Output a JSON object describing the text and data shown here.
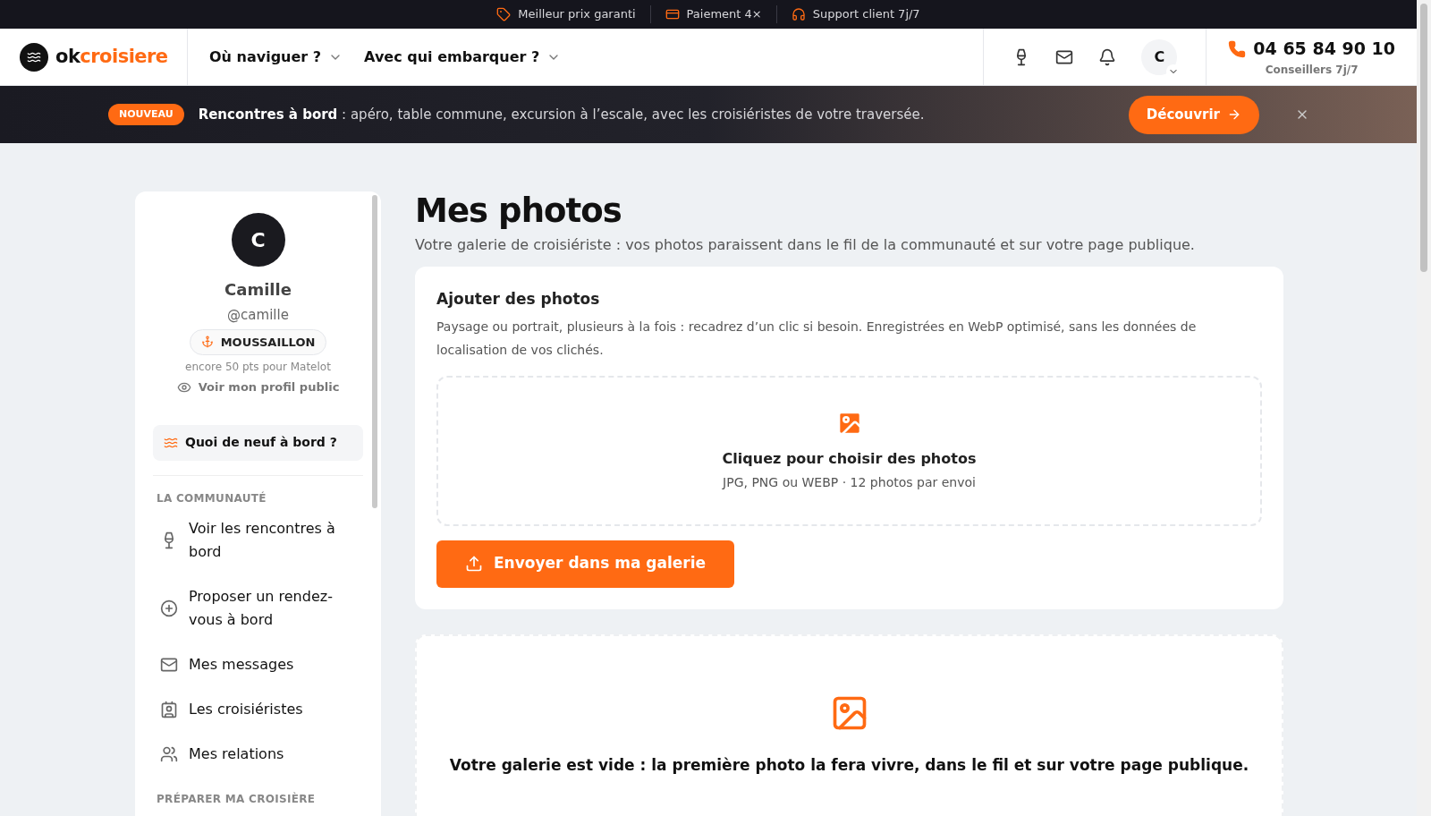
{
  "top_bar": [
    "Meilleur prix garanti",
    "Paiement 4×",
    "Support client 7j/7"
  ],
  "header": {
    "logo": {
      "part1": "ok",
      "part2": "croisiere"
    },
    "nav": [
      "Où naviguer ?",
      "Avec qui embarquer ?"
    ],
    "avatar": "C",
    "phone": "04 65 84 90 10",
    "phone_note": "Conseillers 7j/7"
  },
  "banner": {
    "badge": "NOUVEAU",
    "text": "**Rencontres à bord** : apéro, table commune, excursion à l’escale, avec les croisiéristes de votre traversée.",
    "button": "Découvrir"
  },
  "sidebar": {
    "avatar": "C",
    "name": "Camille",
    "handle": "@camille",
    "rank": "MOUSSAILLON",
    "progress": "encore 50 pts pour Matelot",
    "profile_link": "Voir mon profil public",
    "feed_button": "Quoi de neuf à bord ?",
    "sections": [
      {
        "title": "LA COMMUNAUTÉ",
        "items": [
          "Voir les rencontres à bord",
          "Proposer un rendez-vous à bord",
          "Mes messages",
          "Les croisiéristes",
          "Mes relations"
        ]
      },
      {
        "title": "PRÉPARER MA CROISIÈRE"
      }
    ]
  },
  "main": {
    "title": "Mes photos",
    "subtitle": "Votre galerie de croisiériste : vos photos paraissent dans le fil de la communauté et sur votre page publique.",
    "upload": {
      "title": "Ajouter des photos",
      "description": "Paysage ou portrait, plusieurs à la fois : recadrez d’un clic si besoin. Enregistrées en WebP optimisé, sans les données de localisation de vos clichés.",
      "drop_title": "Cliquez pour choisir des photos",
      "drop_hint": "JPG, PNG ou WEBP · 12 photos par envoi",
      "button": "Envoyer dans ma galerie"
    },
    "empty": {
      "text": "Votre galerie est vide : la première photo la fera vivre, dans le fil et sur votre page publique."
    }
  }
}
